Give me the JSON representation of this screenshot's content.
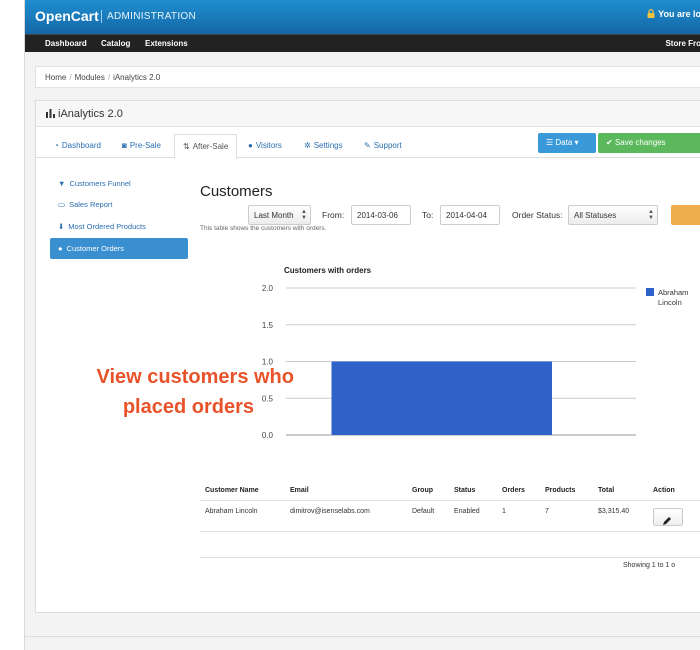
{
  "header": {
    "brand": "OpenCart",
    "brand_sub": "ADMINISTRATION",
    "user_text": "You are lo"
  },
  "nav": {
    "items": [
      "Dashboard",
      "Catalog",
      "Extensions"
    ],
    "right": "Store Fro"
  },
  "breadcrumb": [
    "Home",
    "Modules",
    "iAnalytics 2.0"
  ],
  "panel": {
    "title": "iAnalytics 2.0",
    "tabs": [
      "Dashboard",
      "Pre-Sale",
      "After-Sale",
      "Visitors",
      "Settings",
      "Support"
    ],
    "active_tab": "After-Sale",
    "data_button": "Data",
    "save_button": "Save changes"
  },
  "side_menu": {
    "items": [
      "Customers Funnel",
      "Sales Report",
      "Most Ordered Products",
      "Customer Orders"
    ],
    "active_item": "Customer Orders"
  },
  "content": {
    "title": "Customers",
    "range_select": "Last Month",
    "from_label": "From:",
    "from_value": "2014-03-06",
    "to_label": "To:",
    "to_value": "2014-04-04",
    "status_label": "Order Status:",
    "status_select": "All Statuses",
    "hint": "This table shows the customers with orders."
  },
  "chart_data": {
    "type": "bar",
    "title": "Customers with orders",
    "categories": [
      ""
    ],
    "series": [
      {
        "name": "Abraham Lincoln",
        "values": [
          1
        ]
      }
    ],
    "ylim": [
      0,
      2
    ],
    "yticks": [
      "2.0",
      "1.5",
      "1.0",
      "0.5",
      "0.0"
    ],
    "legend_lines": [
      "Abraham",
      "Lincoln"
    ],
    "legend_position": "right",
    "grid": true,
    "colors": {
      "bar": "#2f62c8",
      "grid": "#cccccc"
    }
  },
  "overlay": {
    "line1": "View customers who",
    "line2": "placed orders",
    "color": "#e8532a"
  },
  "table": {
    "columns": [
      "Customer Name",
      "Email",
      "Group",
      "Status",
      "Orders",
      "Products",
      "Total",
      "Action"
    ],
    "rows": [
      [
        "Abraham Lincoln",
        "dimitrov@isenselabs.com",
        "Default",
        "Enabled",
        "1",
        "7",
        "$3,315.40"
      ]
    ],
    "showing": "Showing 1 to 1 o"
  }
}
